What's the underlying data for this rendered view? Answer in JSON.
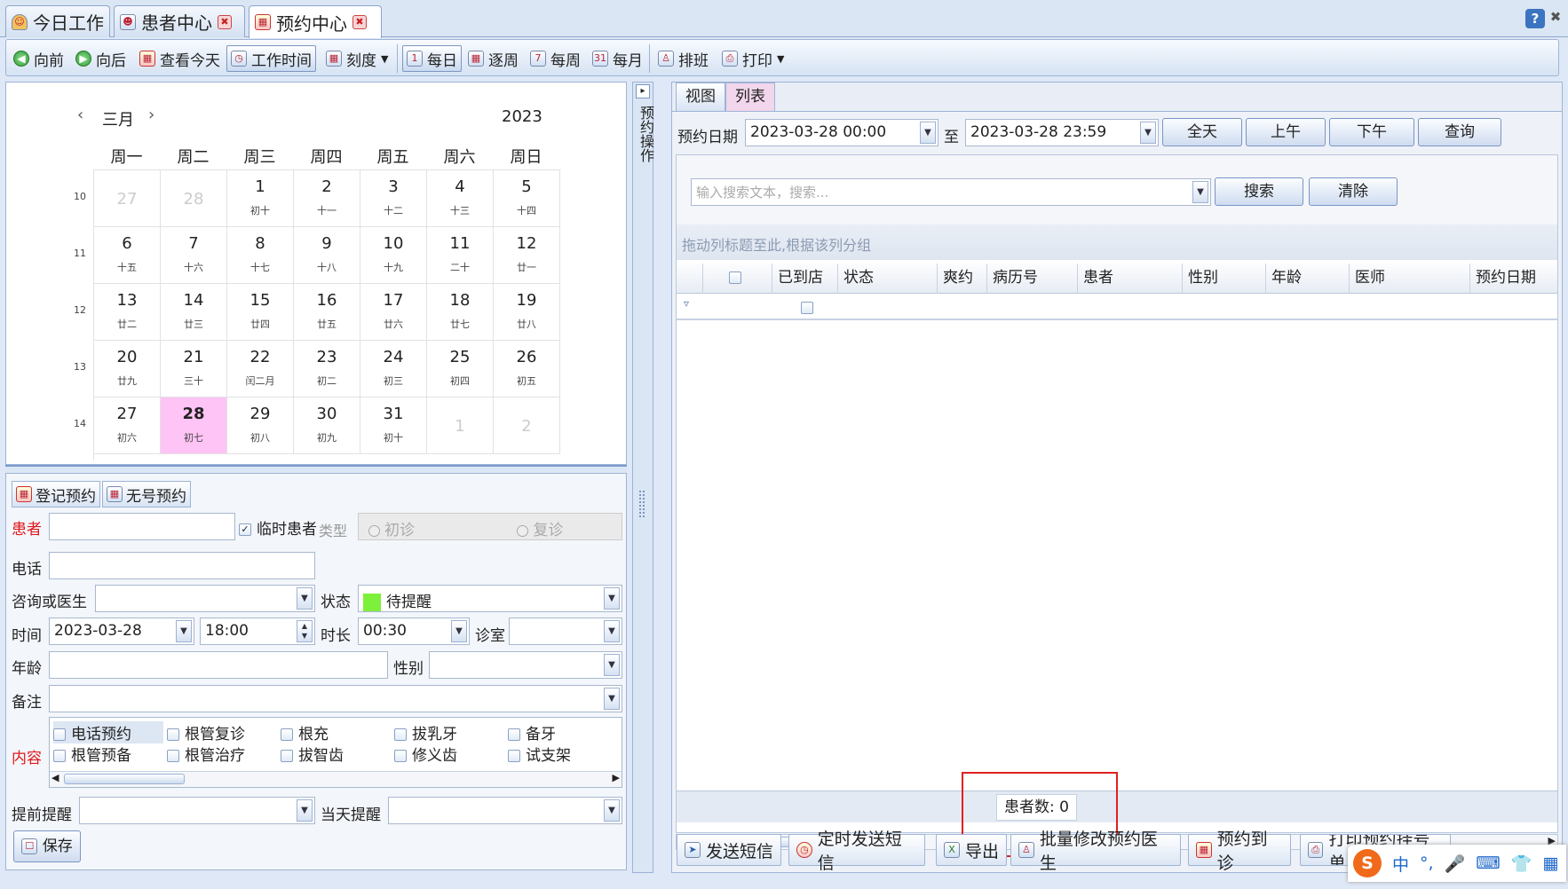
{
  "tabs": [
    {
      "label": "今日工作"
    },
    {
      "label": "患者中心"
    },
    {
      "label": "预约中心"
    }
  ],
  "toolbar": {
    "back": "向前",
    "forward": "向后",
    "today": "查看今天",
    "worktime": "工作时间",
    "scale": "刻度",
    "daily": "每日",
    "byweek": "逐周",
    "weekly": "每周",
    "monthly": "每月",
    "schedule": "排班",
    "print": "打印"
  },
  "calendar": {
    "month": "三月",
    "year": "2023",
    "weekdays": [
      "周一",
      "周二",
      "周三",
      "周四",
      "周五",
      "周六",
      "周日"
    ],
    "weeks": [
      {
        "num": "10",
        "days": [
          {
            "d": "27",
            "l": ""
          },
          {
            "d": "28",
            "l": ""
          },
          {
            "d": "1",
            "l": "初十"
          },
          {
            "d": "2",
            "l": "十一"
          },
          {
            "d": "3",
            "l": "十二"
          },
          {
            "d": "4",
            "l": "十三"
          },
          {
            "d": "5",
            "l": "十四"
          }
        ]
      },
      {
        "num": "11",
        "days": [
          {
            "d": "6",
            "l": "十五"
          },
          {
            "d": "7",
            "l": "十六"
          },
          {
            "d": "8",
            "l": "十七"
          },
          {
            "d": "9",
            "l": "十八"
          },
          {
            "d": "10",
            "l": "十九"
          },
          {
            "d": "11",
            "l": "二十"
          },
          {
            "d": "12",
            "l": "廿一"
          }
        ]
      },
      {
        "num": "12",
        "days": [
          {
            "d": "13",
            "l": "廿二"
          },
          {
            "d": "14",
            "l": "廿三"
          },
          {
            "d": "15",
            "l": "廿四"
          },
          {
            "d": "16",
            "l": "廿五"
          },
          {
            "d": "17",
            "l": "廿六"
          },
          {
            "d": "18",
            "l": "廿七"
          },
          {
            "d": "19",
            "l": "廿八"
          }
        ]
      },
      {
        "num": "13",
        "days": [
          {
            "d": "20",
            "l": "廿九"
          },
          {
            "d": "21",
            "l": "三十"
          },
          {
            "d": "22",
            "l": "闰二月"
          },
          {
            "d": "23",
            "l": "初二"
          },
          {
            "d": "24",
            "l": "初三"
          },
          {
            "d": "25",
            "l": "初四"
          },
          {
            "d": "26",
            "l": "初五"
          }
        ]
      },
      {
        "num": "14",
        "days": [
          {
            "d": "27",
            "l": "初六"
          },
          {
            "d": "28",
            "l": "初七"
          },
          {
            "d": "29",
            "l": "初八"
          },
          {
            "d": "30",
            "l": "初九"
          },
          {
            "d": "31",
            "l": "初十"
          },
          {
            "d": "1",
            "l": ""
          },
          {
            "d": "2",
            "l": ""
          }
        ]
      }
    ],
    "selected_color": "#ffc4f6"
  },
  "sidebar_vertical_label": "预约操作",
  "form": {
    "tabs": [
      "登记预约",
      "无号预约"
    ],
    "patient_label": "患者",
    "temp_patient": "临时患者",
    "type_label": "类型",
    "first_visit": "初诊",
    "revisit": "复诊",
    "phone_label": "电话",
    "doctor_label": "咨询或医生",
    "status_label": "状态",
    "status_value": "待提醒",
    "status_color": "#7df03b",
    "time_label": "时间",
    "date_value": "2023-03-28",
    "time_value": "18:00",
    "duration_label": "时长",
    "duration_value": "00:30",
    "room_label": "诊室",
    "age_label": "年龄",
    "gender_label": "性别",
    "note_label": "备注",
    "content_label": "内容",
    "content_items": [
      "电话预约",
      "根管复诊",
      "根充",
      "拔乳牙",
      "备牙",
      "根管预备",
      "根管治疗",
      "拔智齿",
      "修义齿",
      "试支架"
    ],
    "remind_label": "提前提醒",
    "sameday_label": "当天提醒",
    "save": "保存"
  },
  "right": {
    "tabs": [
      "视图",
      "列表"
    ],
    "date_label": "预约日期",
    "from": "2023-03-28 00:00",
    "to_label": "至",
    "to": "2023-03-28 23:59",
    "btn_allday": "全天",
    "btn_am": "上午",
    "btn_pm": "下午",
    "btn_query": "查询",
    "search_placeholder": "输入搜索文本，搜索...",
    "btn_search": "搜索",
    "btn_clear": "清除",
    "group_hint": "拖动列标题至此,根据该列分组",
    "columns": [
      "已到店",
      "状态",
      "爽约",
      "病历号",
      "患者",
      "性别",
      "年龄",
      "医师",
      "预约日期"
    ],
    "count_label": "患者数:",
    "count_value": "0",
    "bottom_buttons": [
      "发送短信",
      "定时发送短信",
      "导出",
      "批量修改预约医生",
      "预约到诊",
      "打印预约挂号单"
    ],
    "highlight_color": "#e02020"
  },
  "ime": {
    "chars": [
      "中",
      "°,",
      "🎤",
      "⌨",
      "👕",
      "▦"
    ]
  }
}
